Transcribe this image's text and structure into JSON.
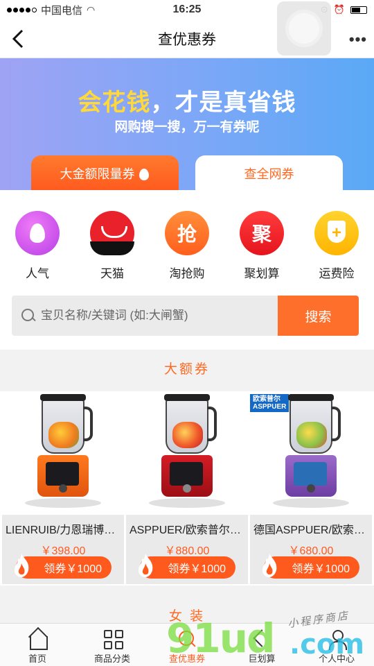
{
  "status_bar": {
    "carrier": "中国电信",
    "time": "16:25"
  },
  "nav": {
    "title": "查优惠券",
    "more": "•••"
  },
  "banner": {
    "slogan_highlight": "会花钱",
    "slogan_rest": "，才是真省钱",
    "subtitle": "网购搜一搜，万一有券呢",
    "tabs": [
      {
        "label": "大金额限量券",
        "active": true
      },
      {
        "label": "查全网券",
        "active": false
      }
    ]
  },
  "categories": [
    {
      "label": "人气",
      "icon": "flame-icon"
    },
    {
      "label": "天猫",
      "icon": "tmall-icon"
    },
    {
      "label": "淘抢购",
      "icon": "grab-icon",
      "glyph": "抢"
    },
    {
      "label": "聚划算",
      "icon": "ju-icon",
      "glyph": "聚"
    },
    {
      "label": "运费险",
      "icon": "shield-plus-icon",
      "glyph": "+"
    }
  ],
  "search": {
    "placeholder": "宝贝名称/关键词 (如:大闸蟹)",
    "button": "搜索"
  },
  "section_big": {
    "title": "大额券"
  },
  "products": [
    {
      "name": "LIENRUIB/力恩瑞博…",
      "price": "￥398.00",
      "coupon": "领券￥1000",
      "color": "orange"
    },
    {
      "name": "ASPPUER/欧索普尔…",
      "price": "￥880.00",
      "coupon": "领券￥1000",
      "color": "red"
    },
    {
      "name": "德国ASPPUER/欧索…",
      "price": "￥680.00",
      "coupon": "领券￥1000",
      "color": "purple",
      "brand_tag_cn": "欧索普尔",
      "brand_tag_en": "ASPPUER"
    }
  ],
  "section_female": {
    "title": "女 装"
  },
  "tab_bar": [
    {
      "label": "首页",
      "icon": "home-icon",
      "active": false
    },
    {
      "label": "商品分类",
      "icon": "category-grid-icon",
      "active": false
    },
    {
      "label": "查优惠券",
      "icon": "search-coupon-icon",
      "active": true
    },
    {
      "label": "巨划算",
      "icon": "deal-icon",
      "active": false
    },
    {
      "label": "个人中心",
      "icon": "user-icon",
      "active": false
    }
  ],
  "watermark": {
    "brand": "91ud",
    "suffix": ".com",
    "tagline": "小程序商店"
  },
  "colors": {
    "accent": "#ff6a23",
    "banner_start": "#9fa3f4",
    "banner_end": "#5aa9f6",
    "highlight": "#ffd83a"
  }
}
